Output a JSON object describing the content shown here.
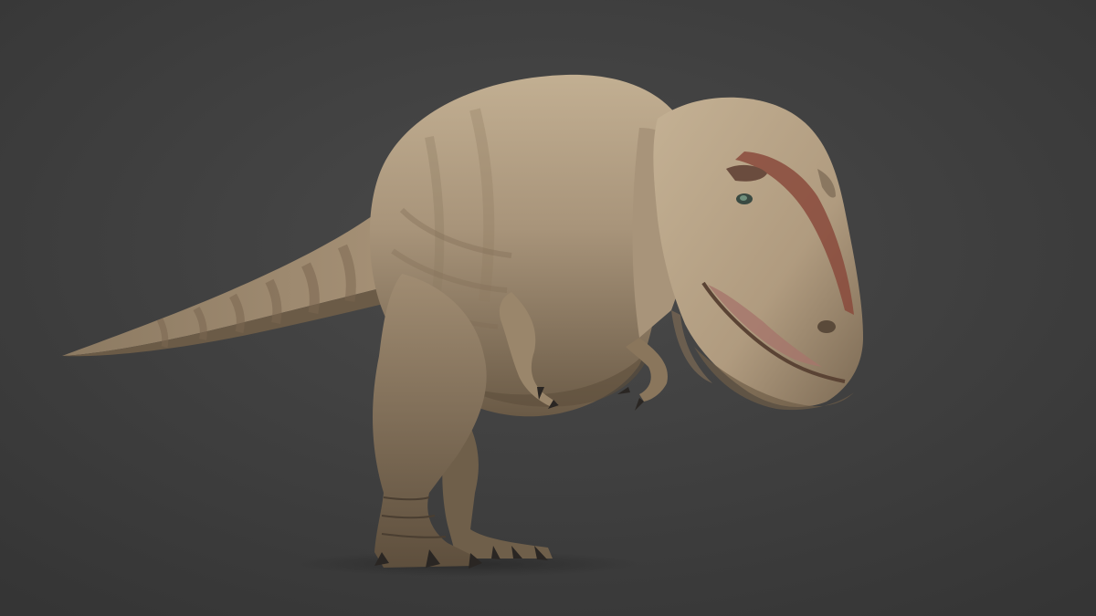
{
  "scene": {
    "subject": "dinosaur-render",
    "colors": {
      "background": "#3d3d3d",
      "background_center": "#484848",
      "skin_light": "#bba88c",
      "skin_mid": "#9b876a",
      "skin_dark": "#6e5d47",
      "skin_shadow": "#4d4133",
      "stripe": "#7a6650",
      "crest_red": "#8a4a3c",
      "mouth_pink": "#a6766c",
      "claw": "#2a2623",
      "eye": "#4f6a5a"
    }
  }
}
